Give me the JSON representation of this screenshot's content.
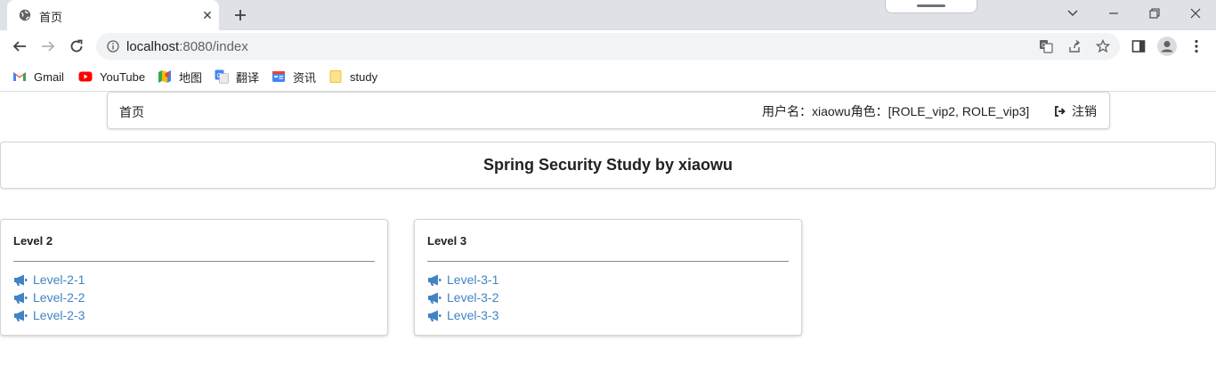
{
  "browser": {
    "tab_title": "首页",
    "url_host": "localhost",
    "url_rest": ":8080/index",
    "bookmarks": [
      {
        "label": "Gmail",
        "icon": "gmail-icon"
      },
      {
        "label": "YouTube",
        "icon": "youtube-icon"
      },
      {
        "label": "地图",
        "icon": "maps-icon"
      },
      {
        "label": "翻译",
        "icon": "translate-icon"
      },
      {
        "label": "资讯",
        "icon": "news-icon"
      },
      {
        "label": "study",
        "icon": "folder-icon"
      }
    ]
  },
  "menu": {
    "home": "首页",
    "user_info": "用户名：xiaowu角色：[ROLE_vip2, ROLE_vip3]",
    "logout": "注销"
  },
  "banner": {
    "title": "Spring Security Study by xiaowu"
  },
  "cards": [
    {
      "title": "Level 2",
      "links": [
        "Level-2-1",
        "Level-2-2",
        "Level-2-3"
      ]
    },
    {
      "title": "Level 3",
      "links": [
        "Level-3-1",
        "Level-3-2",
        "Level-3-3"
      ]
    }
  ],
  "colors": {
    "link": "#4183c4",
    "chrome_bg": "#dee1e6"
  }
}
